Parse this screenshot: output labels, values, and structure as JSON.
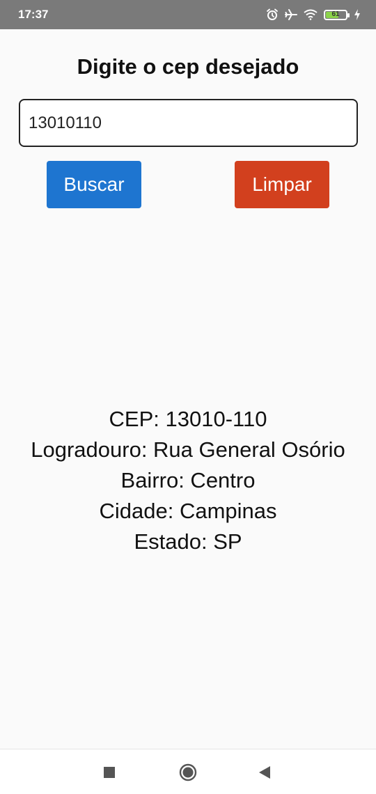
{
  "status_bar": {
    "time": "17:37",
    "battery_level": "61",
    "battery_fraction": 0.61,
    "icons": [
      "alarm-icon",
      "airplane-icon",
      "wifi-icon",
      "battery-icon",
      "charging-icon"
    ]
  },
  "main": {
    "title": "Digite o cep desejado",
    "cep_input_value": "13010110",
    "buscar_label": "Buscar",
    "limpar_label": "Limpar",
    "colors": {
      "buscar": "#1e75d0",
      "limpar": "#d2401e"
    }
  },
  "result": {
    "cep": "CEP: 13010-110",
    "logradouro": "Logradouro: Rua General Osório",
    "bairro": "Bairro: Centro",
    "cidade": "Cidade: Campinas",
    "estado": "Estado: SP"
  },
  "nav_bar": {
    "icons": [
      "recents-square-icon",
      "home-circle-icon",
      "back-triangle-icon"
    ]
  }
}
